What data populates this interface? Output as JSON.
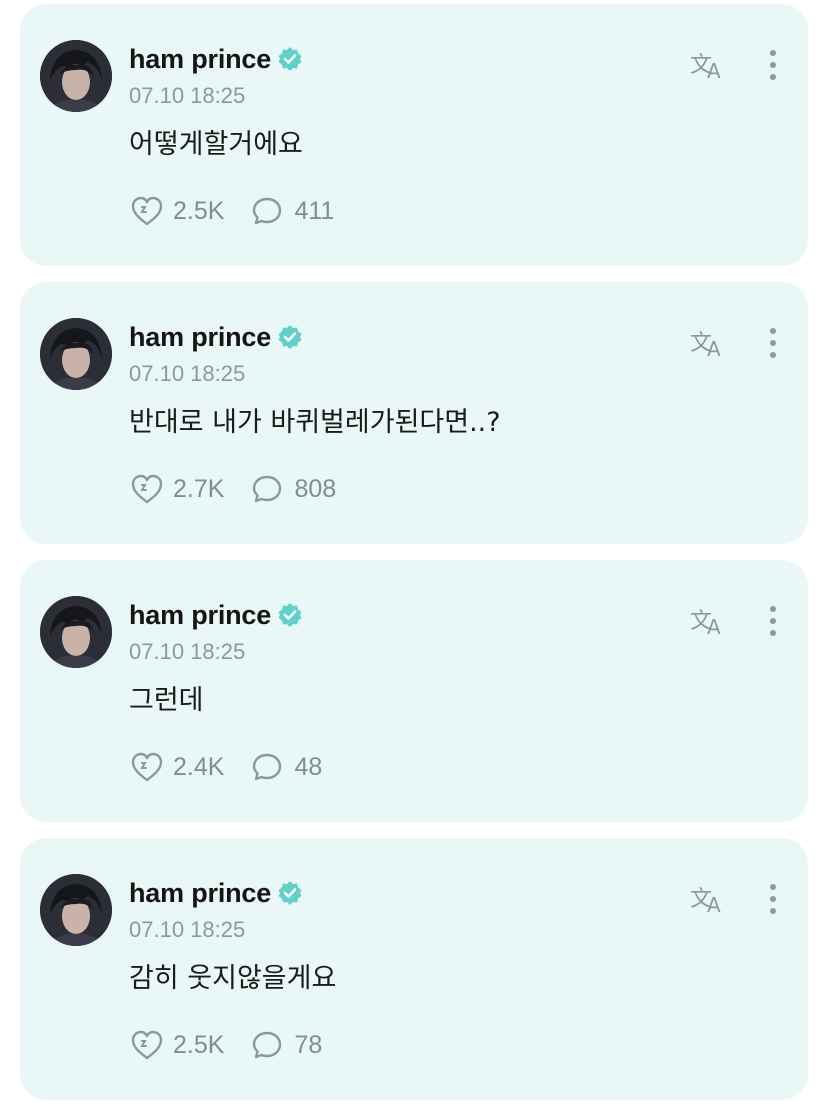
{
  "colors": {
    "card_background": "#e9f8f6",
    "accent": "#7fd6d0",
    "verified": "#5fd1c9",
    "icon": "#8a9a98"
  },
  "icons": {
    "verified": "verified-badge-icon",
    "translate": "translate-icon",
    "more": "more-vertical-icon",
    "heart": "heart-icon",
    "comment": "comment-icon"
  },
  "posts": [
    {
      "author": "ham prince",
      "time": "07.10 18:25",
      "text": "어떻게할거에요",
      "likes": "2.5K",
      "comments": "411"
    },
    {
      "author": "ham prince",
      "time": "07.10 18:25",
      "text": "반대로 내가 바퀴벌레가된다면..?",
      "likes": "2.7K",
      "comments": "808"
    },
    {
      "author": "ham prince",
      "time": "07.10 18:25",
      "text": "그런데",
      "likes": "2.4K",
      "comments": "48"
    },
    {
      "author": "ham prince",
      "time": "07.10 18:25",
      "text": "감히 웃지않을게요",
      "likes": "2.5K",
      "comments": "78"
    }
  ]
}
